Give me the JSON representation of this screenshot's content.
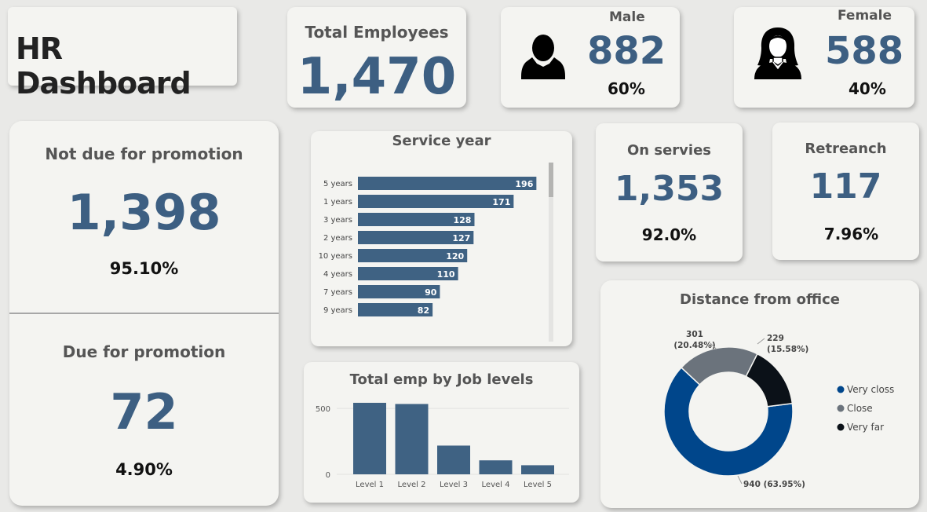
{
  "header": {
    "title": "HR Dashboard"
  },
  "total_employees": {
    "label": "Total Employees",
    "value": "1,470"
  },
  "male": {
    "label": "Male",
    "value": "882",
    "percent": "60%",
    "icon": "male-person-icon"
  },
  "female": {
    "label": "Female",
    "value": "588",
    "percent": "40%",
    "icon": "female-person-icon"
  },
  "promotion": {
    "not_due": {
      "label": "Not due for promotion",
      "value": "1,398",
      "percent": "95.10%"
    },
    "due": {
      "label": "Due for promotion",
      "value": "72",
      "percent": "4.90%"
    }
  },
  "on_service": {
    "label": "On servies",
    "value": "1,353",
    "percent": "92.0%"
  },
  "retrench": {
    "label": "Retreanch",
    "value": "117",
    "percent": "7.96%"
  },
  "colors": {
    "accent": "#3d5f82",
    "very_close": "#00468b",
    "close": "#6b737c",
    "very_far": "#0b1118",
    "bar": "#3f6283"
  },
  "chart_data": [
    {
      "id": "service_year",
      "type": "bar",
      "orientation": "horizontal",
      "title": "Service year",
      "categories": [
        "5 years",
        "1 years",
        "3 years",
        "2 years",
        "10 years",
        "4 years",
        "7 years",
        "9 years"
      ],
      "values": [
        196,
        171,
        128,
        127,
        120,
        110,
        90,
        82
      ],
      "data_labels": [
        "196",
        "171",
        "128",
        "127",
        "120",
        "110",
        "90",
        "82"
      ],
      "xlim": [
        0,
        200
      ],
      "grid": false
    },
    {
      "id": "job_levels",
      "type": "bar",
      "title": "Total emp by Job levels",
      "categories": [
        "Level 1",
        "Level 2",
        "Level 3",
        "Level 4",
        "Level 5"
      ],
      "values": [
        543,
        534,
        218,
        106,
        69
      ],
      "ylim": [
        0,
        650
      ],
      "yticks": [
        0,
        500
      ],
      "ytick_labels": [
        "0",
        "500"
      ],
      "grid": true
    },
    {
      "id": "distance",
      "type": "pie",
      "donut": true,
      "title": "Distance from office",
      "labels": [
        "Very closs",
        "Close",
        "Very far"
      ],
      "values": [
        940,
        301,
        229
      ],
      "data_labels": [
        "940 (63.95%)",
        "301\n(20.48%)",
        "229\n(15.58%)"
      ],
      "legend_position": "right"
    }
  ]
}
